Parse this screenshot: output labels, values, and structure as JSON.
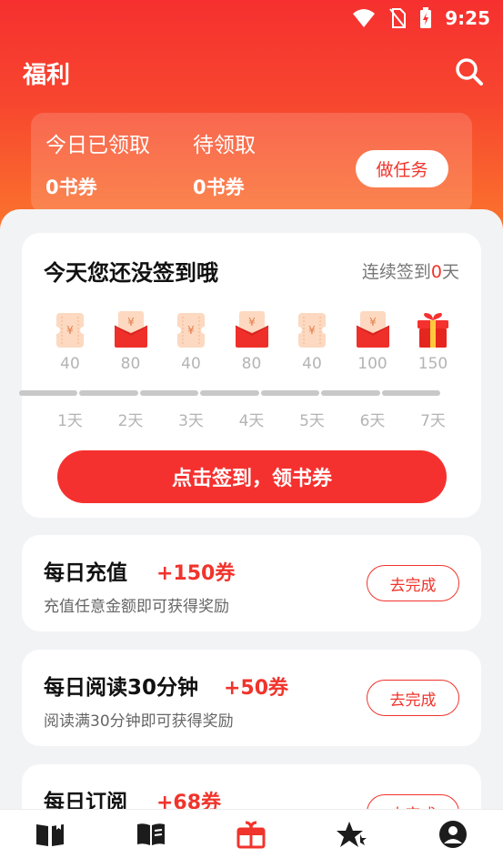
{
  "status_bar": {
    "time": "9:25"
  },
  "header": {
    "title": "福利"
  },
  "wallet": {
    "today_label": "今日已领取",
    "today_value": "0书券",
    "pending_label": "待领取",
    "pending_value": "0书券",
    "task_button": "做任务"
  },
  "checkin": {
    "heading": "今天您还没签到哦",
    "streak_prefix": "连续签到",
    "streak_count": "0",
    "streak_suffix": "天",
    "days": [
      {
        "amount": "40",
        "label": "1天",
        "icon": "ticket-icon"
      },
      {
        "amount": "80",
        "label": "2天",
        "icon": "red-envelope-icon"
      },
      {
        "amount": "40",
        "label": "3天",
        "icon": "ticket-icon"
      },
      {
        "amount": "80",
        "label": "4天",
        "icon": "red-envelope-icon"
      },
      {
        "amount": "40",
        "label": "5天",
        "icon": "ticket-icon"
      },
      {
        "amount": "100",
        "label": "6天",
        "icon": "red-envelope-icon"
      },
      {
        "amount": "150",
        "label": "7天",
        "icon": "gift-box-icon"
      }
    ],
    "sign_button": "点击签到，领书券"
  },
  "tasks": [
    {
      "name": "每日充值",
      "reward": "+150券",
      "desc": "充值任意金额即可获得奖励",
      "button": "去完成"
    },
    {
      "name": "每日阅读30分钟",
      "reward": "+50券",
      "desc": "阅读满30分钟即可获得奖励",
      "button": "去完成"
    },
    {
      "name": "每日订阅",
      "reward": "+68券",
      "desc": "",
      "button": "去完成"
    }
  ],
  "nav": [
    {
      "icon": "bookshelf-icon"
    },
    {
      "icon": "bookstore-icon"
    },
    {
      "icon": "welfare-gift-icon",
      "active": true
    },
    {
      "icon": "featured-star-icon"
    },
    {
      "icon": "profile-icon"
    }
  ],
  "colors": {
    "accent": "#f0342c",
    "header_top": "#f6302f",
    "header_bottom": "#fb7a2c"
  }
}
